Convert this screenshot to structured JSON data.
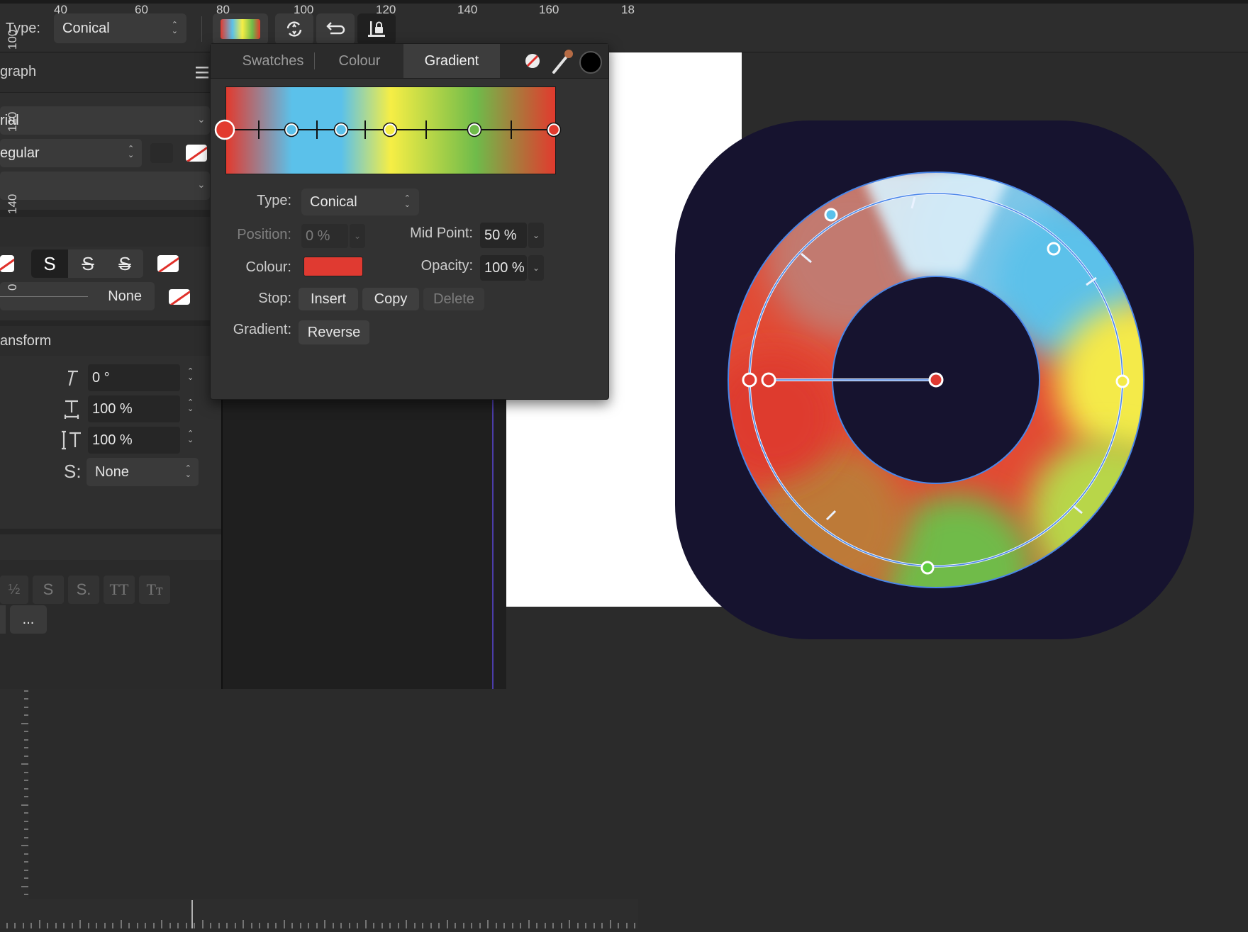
{
  "toolbar": {
    "type_label": "Type:",
    "type_value": "Conical",
    "buttons": [
      "gradient-swatch-icon",
      "flip-icon",
      "reverse-icon",
      "lock-icon"
    ]
  },
  "left_panel": {
    "title": "graph",
    "font_family": "rial",
    "font_style": "egular",
    "style_buttons": [
      "S",
      "S",
      "S"
    ],
    "line_value": "None",
    "transform_title": "ansform",
    "rotation": "0 °",
    "scale_h": "100 %",
    "scale_v": "100 %",
    "shear": "None",
    "bottom_glyphs": [
      "½",
      "S",
      "S.",
      "TT",
      "Tт"
    ],
    "more_label": "..."
  },
  "popover": {
    "tabs": [
      {
        "label": "Swatches",
        "active": false
      },
      {
        "label": "Colour",
        "active": false
      },
      {
        "label": "Gradient",
        "active": true
      }
    ],
    "gradient_stops": [
      {
        "color": "#e23a2e",
        "pos": 0.0
      },
      {
        "color": "#5bc1ea",
        "pos": 0.2
      },
      {
        "color": "#5bc1ea",
        "pos": 0.35
      },
      {
        "color": "#f6ee45",
        "pos": 0.5
      },
      {
        "color": "#6fbb4a",
        "pos": 0.76
      },
      {
        "color": "#e23a2e",
        "pos": 1.0
      }
    ],
    "type_label": "Type:",
    "type_value": "Conical",
    "position_label": "Position:",
    "position_value": "0 %",
    "midpoint_label": "Mid Point:",
    "midpoint_value": "50 %",
    "colour_label": "Colour:",
    "colour_value": "#e03a31",
    "opacity_label": "Opacity:",
    "opacity_value": "100 %",
    "stop_label": "Stop:",
    "insert_label": "Insert",
    "copy_label": "Copy",
    "delete_label": "Delete",
    "gradient_label": "Gradient:",
    "reverse_label": "Reverse"
  },
  "rulers": {
    "top_ticks": [
      "40",
      "60",
      "80",
      "100",
      "120",
      "140",
      "160",
      "18"
    ],
    "left_ticks": [
      "100",
      "120",
      "140",
      "0"
    ]
  },
  "colors": {
    "accent_red": "#e03a31",
    "icon_bg": "#16132f",
    "selection_blue": "#4a86e8"
  }
}
